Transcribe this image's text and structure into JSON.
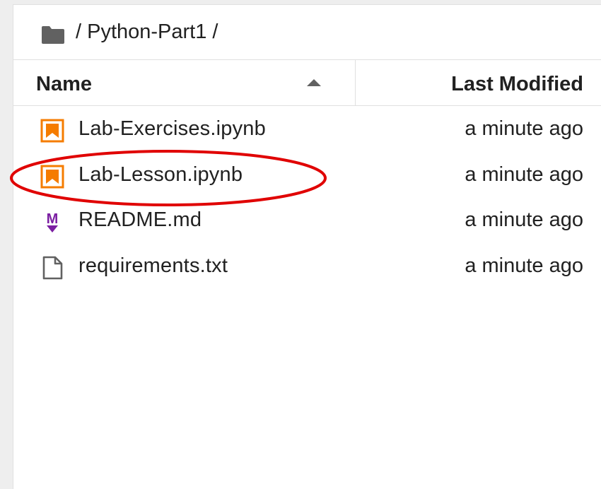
{
  "breadcrumb": {
    "path": "/ Python-Part1 /",
    "icon": "folder-icon"
  },
  "header": {
    "name_label": "Name",
    "modified_label": "Last Modified",
    "sort_icon": "sort-ascending-icon"
  },
  "files": [
    {
      "name": "Lab-Exercises.ipynb",
      "modified": "a minute ago",
      "icon": "notebook-icon"
    },
    {
      "name": "Lab-Lesson.ipynb",
      "modified": "a minute ago",
      "icon": "notebook-icon"
    },
    {
      "name": "README.md",
      "modified": "a minute ago",
      "icon": "markdown-icon"
    },
    {
      "name": "requirements.txt",
      "modified": "a minute ago",
      "icon": "file-icon"
    }
  ],
  "colors": {
    "notebook_accent": "#f57c00",
    "markdown_accent": "#7b1fa2",
    "annotation": "#e00000",
    "text": "#212121",
    "border": "#e0e0e0"
  }
}
